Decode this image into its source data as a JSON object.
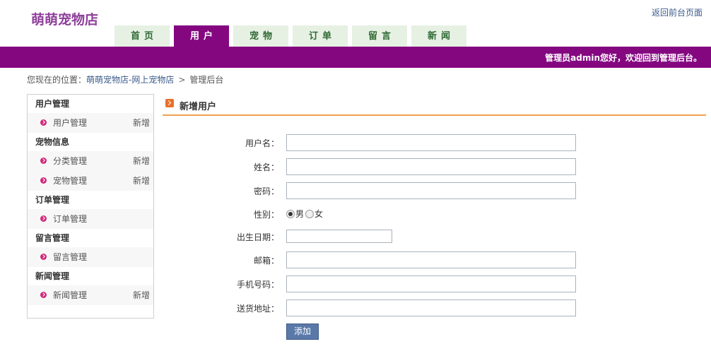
{
  "header": {
    "site_name": "萌萌宠物店",
    "front_link": "返回前台页面",
    "welcome": "管理员admin您好，欢迎回到管理后台。"
  },
  "nav": {
    "tabs": [
      {
        "label": "首页",
        "active": false
      },
      {
        "label": "用户",
        "active": true
      },
      {
        "label": "宠物",
        "active": false
      },
      {
        "label": "订单",
        "active": false
      },
      {
        "label": "留言",
        "active": false
      },
      {
        "label": "新闻",
        "active": false
      }
    ]
  },
  "breadcrumb": {
    "prefix": "您现在的位置：",
    "link": "萌萌宠物店-网上宠物店",
    "separator": ">",
    "current": "管理后台"
  },
  "sidebar": {
    "groups": [
      {
        "title": "用户管理",
        "items": [
          {
            "label": "用户管理",
            "add": "新增"
          }
        ]
      },
      {
        "title": "宠物信息",
        "items": [
          {
            "label": "分类管理",
            "add": "新增"
          },
          {
            "label": "宠物管理",
            "add": "新增"
          }
        ]
      },
      {
        "title": "订单管理",
        "items": [
          {
            "label": "订单管理",
            "add": ""
          }
        ]
      },
      {
        "title": "留言管理",
        "items": [
          {
            "label": "留言管理",
            "add": ""
          }
        ]
      },
      {
        "title": "新闻管理",
        "items": [
          {
            "label": "新闻管理",
            "add": "新增"
          }
        ]
      }
    ]
  },
  "panel": {
    "title": "新增用户"
  },
  "form": {
    "username_label": "用户名：",
    "username_value": "",
    "name_label": "姓名：",
    "name_value": "",
    "password_label": "密码：",
    "password_value": "",
    "gender_label": "性别：",
    "gender_male": "男",
    "gender_female": "女",
    "gender_selected": "男",
    "birth_label": "出生日期：",
    "birth_value": "",
    "email_label": "邮箱：",
    "email_value": "",
    "phone_label": "手机号码：",
    "phone_value": "",
    "address_label": "送货地址：",
    "address_value": "",
    "submit_label": "添加"
  },
  "colors": {
    "brand_purple": "#840780",
    "logo": "#8e3f9a",
    "tab_bg": "#e6f1e4",
    "tab_text": "#2f6a34",
    "accent_orange": "#f0a050",
    "button_blue": "#5a79a8"
  }
}
